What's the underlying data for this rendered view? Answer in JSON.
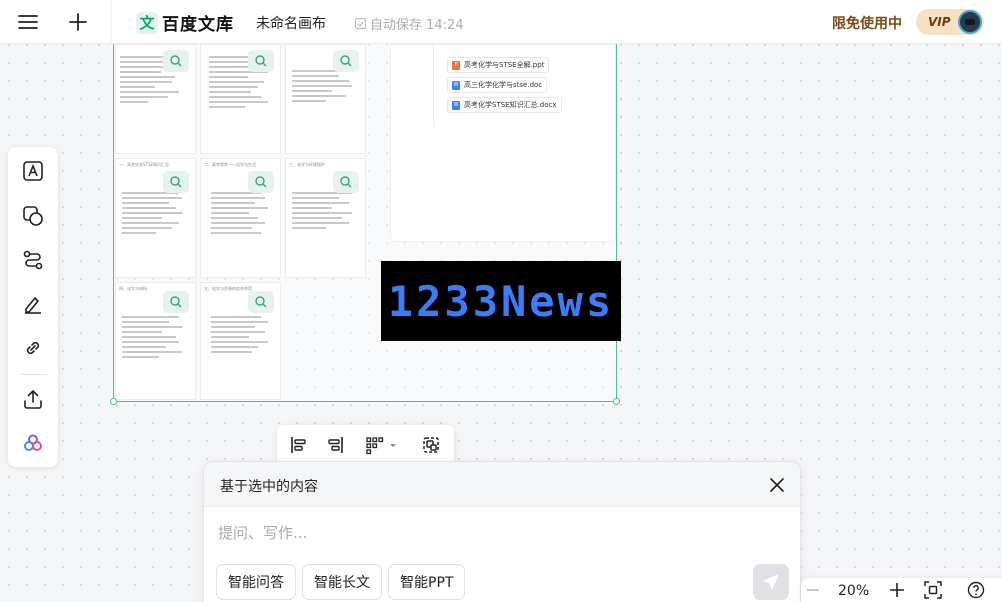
{
  "header": {
    "logo_mark": "文",
    "logo_text": "百度文库",
    "doc_title": "未命名画布",
    "autosave": "自动保存 14:24",
    "free_use": "限免使用中",
    "vip_label": "VIP"
  },
  "canvas": {
    "thumbnails": [
      {
        "title": ""
      },
      {
        "title": ""
      },
      {
        "title": ""
      },
      {
        "title": "一、高考化学STSE知识汇总"
      },
      {
        "title": "二、高考常考——化学与生活"
      },
      {
        "title": "三、化学与环境保护"
      },
      {
        "title": "四、化学与材料"
      },
      {
        "title": "五、化学与资源的综合利用"
      }
    ],
    "files": [
      {
        "label": "高考化学与STSE全解.ppt",
        "type": "P",
        "color": "#e8743b"
      },
      {
        "label": "高三化学化学与stse.doc",
        "type": "W",
        "color": "#3d7ff5"
      },
      {
        "label": "高考化学STSE知识汇总.docx",
        "type": "W",
        "color": "#3d7ff5"
      }
    ],
    "watermark": "1233News"
  },
  "ai_panel": {
    "title": "基于选中的内容",
    "placeholder": "提问、写作...",
    "chips": [
      "智能问答",
      "智能长文",
      "智能PPT"
    ]
  },
  "zoom": {
    "value": "20%"
  }
}
